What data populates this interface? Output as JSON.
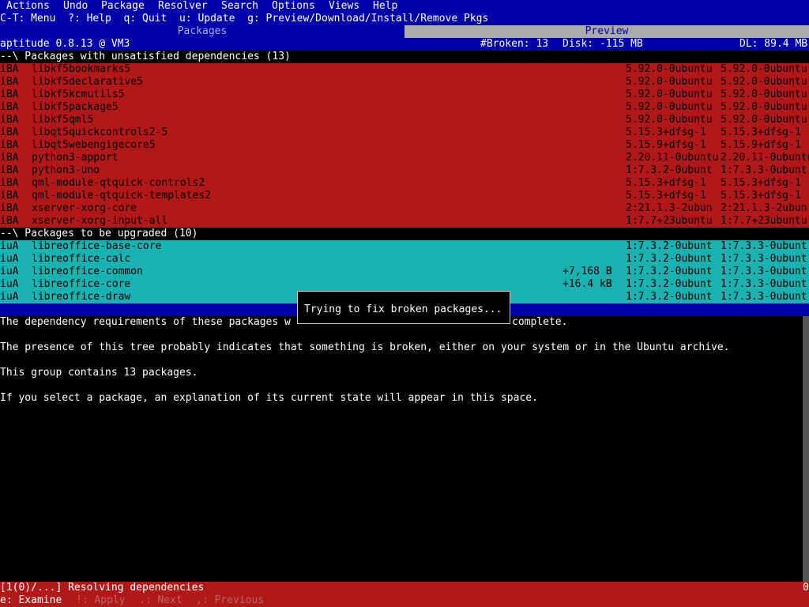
{
  "menubar": {
    "items": [
      "Actions",
      "Undo",
      "Package",
      "Resolver",
      "Search",
      "Options",
      "Views",
      "Help"
    ]
  },
  "shortcuts": "C-T: Menu  ?: Help  q: Quit  u: Update  g: Preview/Download/Install/Remove Pkgs",
  "tabs": {
    "packages": "Packages",
    "preview": "Preview"
  },
  "status_header": {
    "app": "aptitude 0.8.13 @ VM3",
    "broken": "#Broken: 13",
    "disk": "Disk: -115 MB",
    "dl": "DL: 89.4 MB"
  },
  "groups": [
    {
      "header": "--\\ Packages with unsatisfied dependencies (13)",
      "rows": [
        {
          "flags": "iBA",
          "name": "libkf5bookmarks5",
          "size": "",
          "current": "5.92.0-0ubuntu",
          "candidate": "5.92.0-0ubuntu"
        },
        {
          "flags": "iBA",
          "name": "libkf5declarative5",
          "size": "",
          "current": "5.92.0-0ubuntu",
          "candidate": "5.92.0-0ubuntu"
        },
        {
          "flags": "iBA",
          "name": "libkf5kcmutils5",
          "size": "",
          "current": "5.92.0-0ubuntu",
          "candidate": "5.92.0-0ubuntu"
        },
        {
          "flags": "iBA",
          "name": "libkf5package5",
          "size": "",
          "current": "5.92.0-0ubuntu",
          "candidate": "5.92.0-0ubuntu"
        },
        {
          "flags": "iBA",
          "name": "libkf5qml5",
          "size": "",
          "current": "5.92.0-0ubuntu",
          "candidate": "5.92.0-0ubuntu"
        },
        {
          "flags": "iBA",
          "name": "libqt5quickcontrols2-5",
          "size": "",
          "current": "5.15.3+dfsg-1",
          "candidate": "5.15.3+dfsg-1"
        },
        {
          "flags": "iBA",
          "name": "libqt5webengigecore5",
          "size": "",
          "current": "5.15.9+dfsg-1",
          "candidate": "5.15.9+dfsg-1"
        },
        {
          "flags": "iBA",
          "name": "python3-apport",
          "size": "",
          "current": "2.20.11-0ubuntu",
          "candidate": "2.20.11-0ubuntu"
        },
        {
          "flags": "iBA",
          "name": "python3-uno",
          "size": "",
          "current": "1:7.3.2-0ubunt",
          "candidate": "1:7.3.3-0ubunt"
        },
        {
          "flags": "iBA",
          "name": "qml-module-qtquick-controls2",
          "size": "",
          "current": "5.15.3+dfsg-1",
          "candidate": "5.15.3+dfsg-1"
        },
        {
          "flags": "iBA",
          "name": "qml-module-qtquick-templates2",
          "size": "",
          "current": "5.15.3+dfsg-1",
          "candidate": "5.15.3+dfsg-1"
        },
        {
          "flags": "iBA",
          "name": "xserver-xorg-core",
          "size": "",
          "current": "2:21.1.3-2ubun",
          "candidate": "2:21.1.3-2ubun"
        },
        {
          "flags": "iBA",
          "name": "xserver-xorg-input-all",
          "size": "",
          "current": "1:7.7+23ubuntu",
          "candidate": "1:7.7+23ubuntu"
        }
      ]
    },
    {
      "header": "--\\ Packages to be upgraded (10)",
      "rows": [
        {
          "flags": "iuA",
          "name": "libreoffice-base-core",
          "size": "",
          "current": "1:7.3.2-0ubunt",
          "candidate": "1:7.3.3-0ubunt"
        },
        {
          "flags": "iuA",
          "name": "libreoffice-calc",
          "size": "",
          "current": "1:7.3.2-0ubunt",
          "candidate": "1:7.3.3-0ubunt"
        },
        {
          "flags": "iuA",
          "name": "libreoffice-common",
          "size": "+7,168 B",
          "current": "1:7.3.2-0ubunt",
          "candidate": "1:7.3.3-0ubunt"
        },
        {
          "flags": "iuA",
          "name": "libreoffice-core",
          "size": "+16.4 kB",
          "current": "1:7.3.2-0ubunt",
          "candidate": "1:7.3.3-0ubunt"
        },
        {
          "flags": "iuA",
          "name": "libreoffice-draw",
          "size": "",
          "current": "1:7.3.2-0ubunt",
          "candidate": "1:7.3.3-0ubunt"
        }
      ]
    }
  ],
  "description": {
    "line1_left": "The dependency requirements of these packages w",
    "line1_right": "complete.",
    "line2": "The presence of this tree probably indicates that something is broken, either on your system or in the Ubuntu archive.",
    "line3": "This group contains 13 packages.",
    "line4": "If you select a package, an explanation of its current state will appear in this space."
  },
  "popup": {
    "text": "Trying to fix broken packages..."
  },
  "resolver_status": {
    "text": "[1(0)/...] Resolving dependencies",
    "corner": "0"
  },
  "resolver_keys": {
    "examine": "e: Examine",
    "apply": "!: Apply",
    "next": ".: Next",
    "previous": ",: Previous"
  },
  "colors": {
    "menubar": "#0000aa",
    "broken_group": "#b21818",
    "upgrade_group": "#18b2b2"
  }
}
